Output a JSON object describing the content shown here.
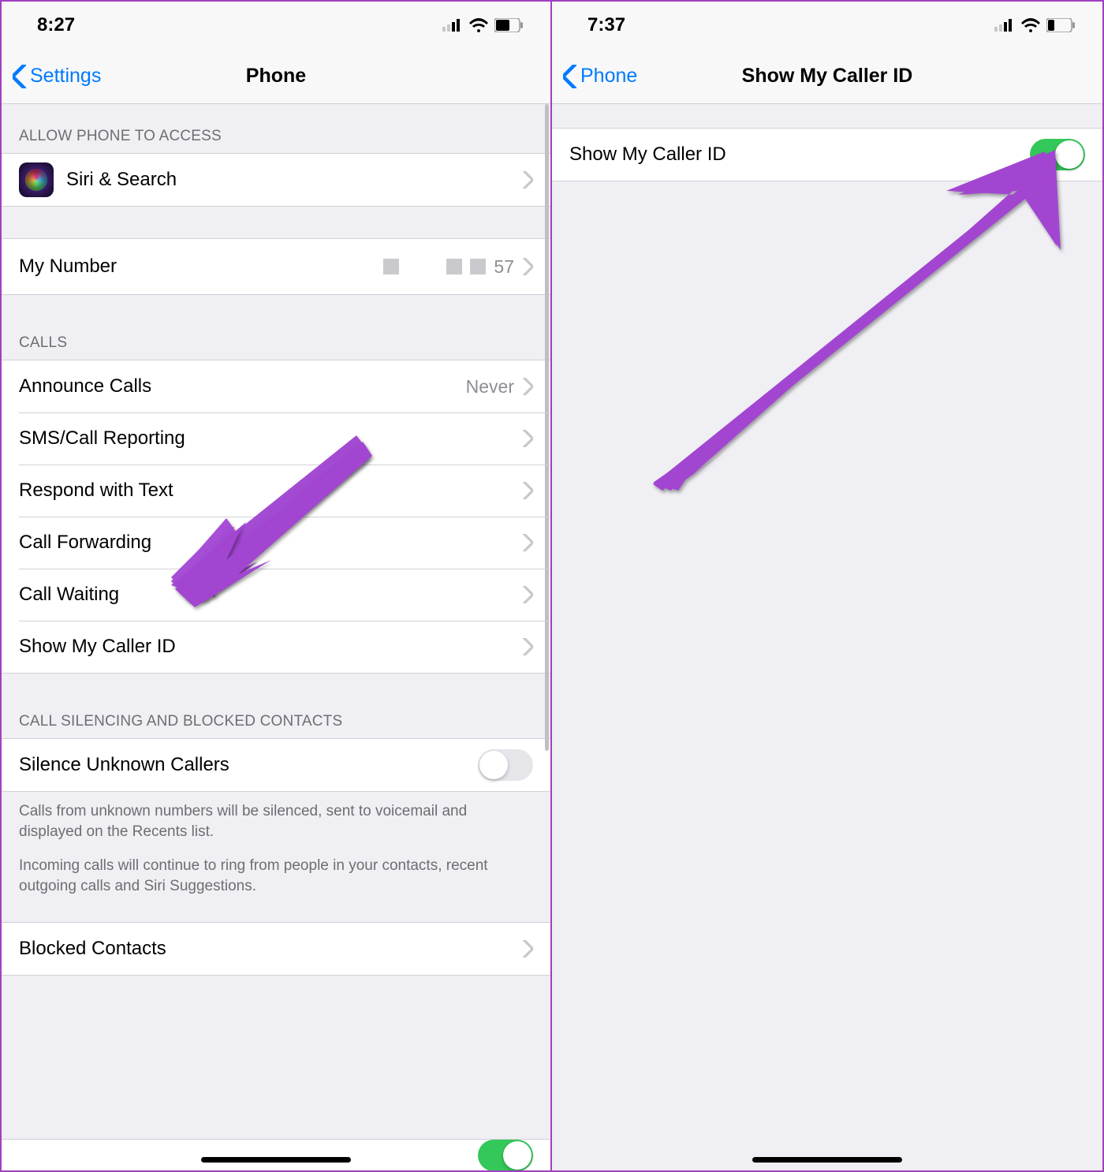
{
  "left": {
    "status_time": "8:27",
    "back_label": "Settings",
    "title": "Phone",
    "sections": {
      "access_header": "ALLOW PHONE TO ACCESS",
      "siri_label": "Siri & Search",
      "my_number_label": "My Number",
      "my_number_value_suffix": "57",
      "calls_header": "CALLS",
      "calls_rows": {
        "announce": {
          "label": "Announce Calls",
          "value": "Never"
        },
        "sms": {
          "label": "SMS/Call Reporting"
        },
        "respond": {
          "label": "Respond with Text"
        },
        "forward": {
          "label": "Call Forwarding"
        },
        "waiting": {
          "label": "Call Waiting"
        },
        "callerid": {
          "label": "Show My Caller ID"
        }
      },
      "silence_header": "CALL SILENCING AND BLOCKED CONTACTS",
      "silence_label": "Silence Unknown Callers",
      "silence_on": false,
      "silence_footer_1": "Calls from unknown numbers will be silenced, sent to voicemail and displayed on the Recents list.",
      "silence_footer_2": "Incoming calls will continue to ring from people in your contacts, recent outgoing calls and Siri Suggestions.",
      "blocked_label": "Blocked Contacts"
    }
  },
  "right": {
    "status_time": "7:37",
    "back_label": "Phone",
    "title": "Show My Caller ID",
    "row_label": "Show My Caller ID",
    "toggle_on": true
  }
}
